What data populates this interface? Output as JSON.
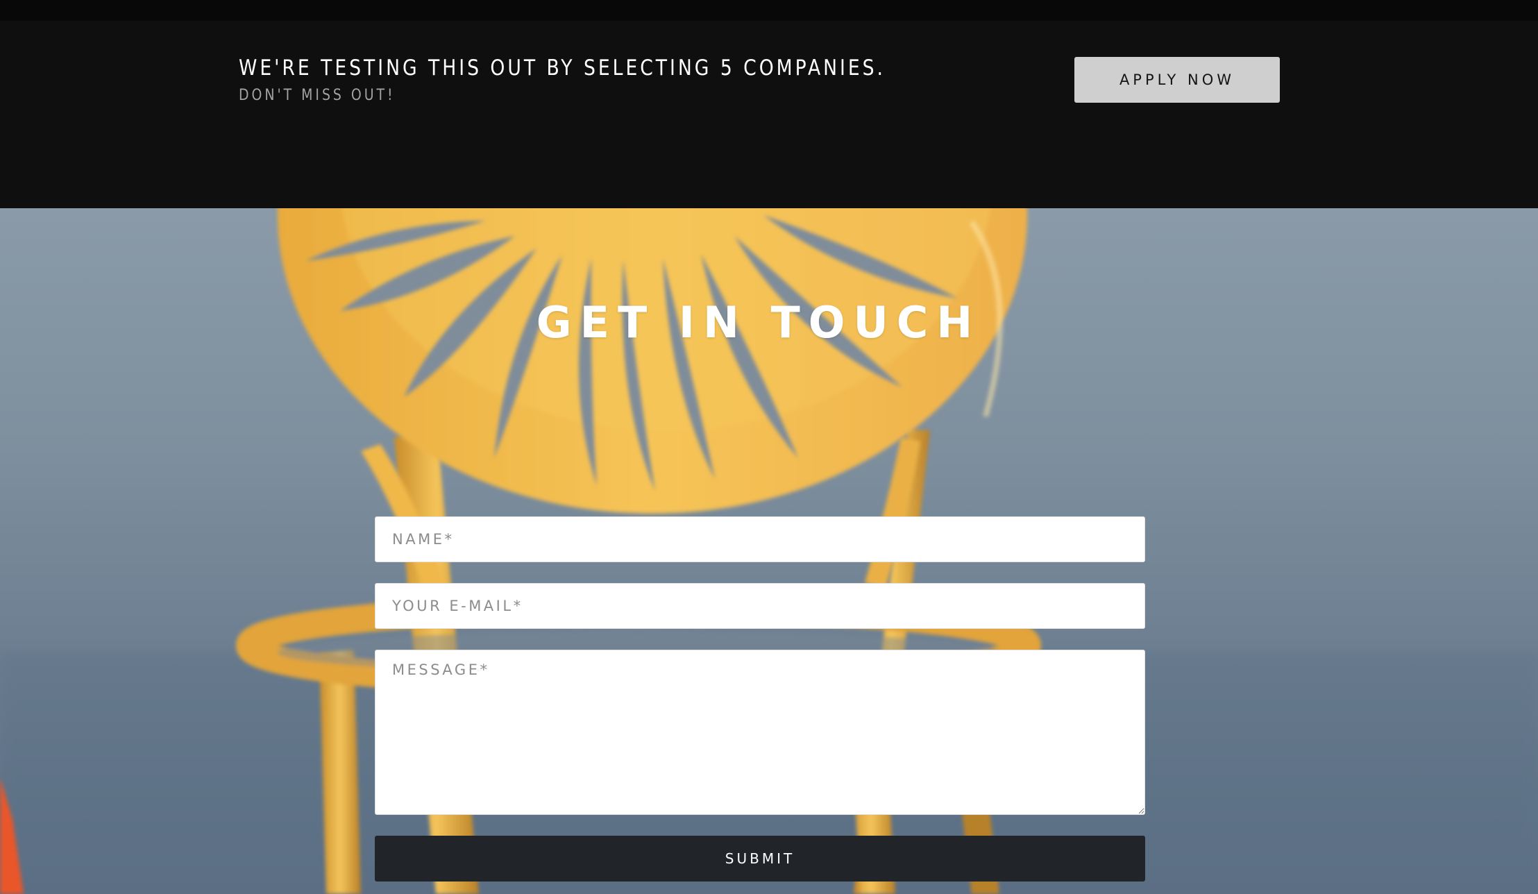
{
  "banner": {
    "headline": "WE'RE TESTING THIS OUT BY SELECTING 5 COMPANIES.",
    "subheadline": "DON'T MISS OUT!",
    "apply_label": "APPLY NOW"
  },
  "contact": {
    "title": "GET IN TOUCH",
    "name_placeholder": "NAME*",
    "email_placeholder": "YOUR E-MAIL*",
    "message_placeholder": "MESSAGE*",
    "submit_label": "SUBMIT"
  },
  "colors": {
    "banner_bg": "#0f0f0f",
    "apply_button_bg": "#cfcfcf",
    "submit_button_bg": "#212429",
    "chair_yellow": "#f3b94a"
  }
}
